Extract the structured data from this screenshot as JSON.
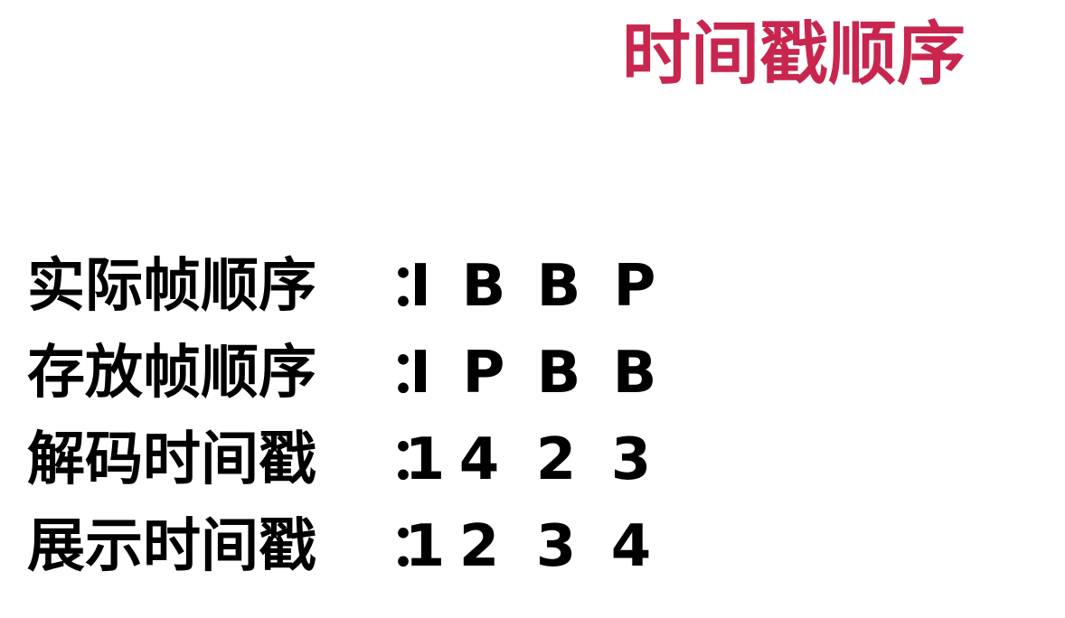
{
  "title": "时间戳顺序",
  "separator": "：",
  "rows": [
    {
      "label": "实际帧顺序",
      "values": [
        "I",
        "B",
        "B",
        "P"
      ]
    },
    {
      "label": "存放帧顺序",
      "values": [
        "I",
        "P",
        "B",
        "B"
      ]
    },
    {
      "label": "解码时间戳",
      "values": [
        "1",
        "4",
        "2",
        "3"
      ]
    },
    {
      "label": "展示时间戳",
      "values": [
        "1",
        "2",
        "3",
        "4"
      ]
    }
  ],
  "colors": {
    "title": "#c8264f",
    "text": "#000000",
    "background": "#ffffff"
  }
}
